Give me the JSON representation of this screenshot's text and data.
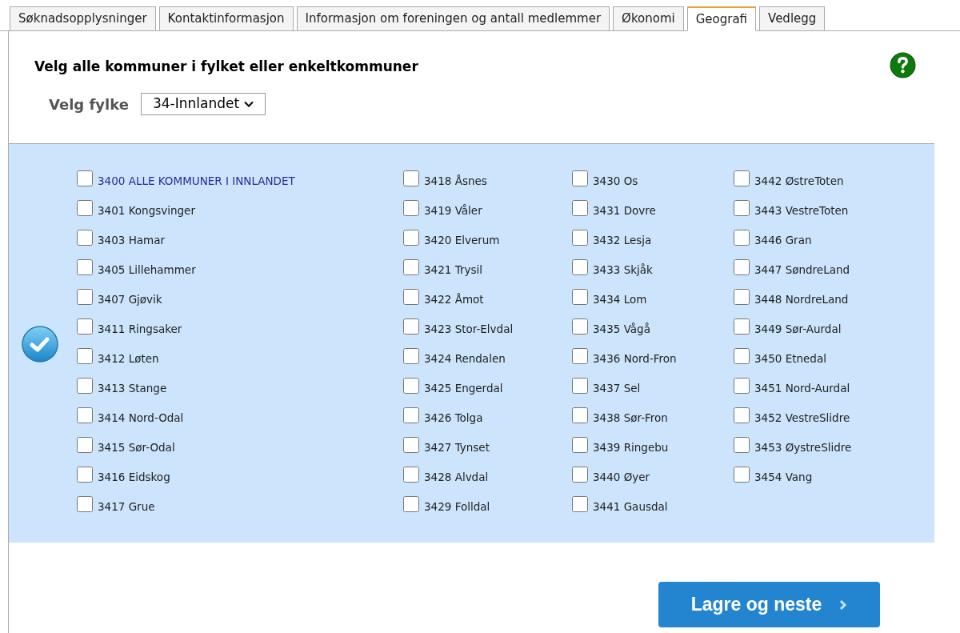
{
  "tabs": [
    {
      "label": "Søknadsopplysninger",
      "selected": false
    },
    {
      "label": "Kontaktinformasjon",
      "selected": false
    },
    {
      "label": "Informasjon om foreningen og antall medlemmer",
      "selected": false
    },
    {
      "label": "Økonomi",
      "selected": false
    },
    {
      "label": "Geografi",
      "selected": true
    },
    {
      "label": "Vedlegg",
      "selected": false
    }
  ],
  "heading": "Velg alle kommuner i fylket eller enkeltkommuner",
  "county": {
    "label": "Velg fylke",
    "value": "34-Innlandet"
  },
  "columns": [
    [
      {
        "label": "3400 ALLE KOMMUNER I INNLANDET",
        "kind": "all",
        "checked": false
      },
      {
        "label": "3401 Kongsvinger",
        "kind": "single",
        "checked": false
      },
      {
        "label": "3403 Hamar",
        "kind": "single",
        "checked": false
      },
      {
        "label": "3405 Lillehammer",
        "kind": "single",
        "checked": false
      },
      {
        "label": "3407 Gjøvik",
        "kind": "single",
        "checked": false
      },
      {
        "label": "3411 Ringsaker",
        "kind": "single",
        "checked": false
      },
      {
        "label": "3412 Løten",
        "kind": "single",
        "checked": false
      },
      {
        "label": "3413 Stange",
        "kind": "single",
        "checked": false
      },
      {
        "label": "3414 Nord-Odal",
        "kind": "single",
        "checked": false
      },
      {
        "label": "3415 Sør-Odal",
        "kind": "single",
        "checked": false
      },
      {
        "label": "3416 Eidskog",
        "kind": "single",
        "checked": false
      },
      {
        "label": "3417 Grue",
        "kind": "single",
        "checked": false
      }
    ],
    [
      {
        "label": "3418 Åsnes",
        "kind": "single",
        "checked": false
      },
      {
        "label": "3419 Våler",
        "kind": "single",
        "checked": false
      },
      {
        "label": "3420 Elverum",
        "kind": "single",
        "checked": false
      },
      {
        "label": "3421 Trysil",
        "kind": "single",
        "checked": false
      },
      {
        "label": "3422 Åmot",
        "kind": "single",
        "checked": false
      },
      {
        "label": "3423 Stor-Elvdal",
        "kind": "single",
        "checked": false
      },
      {
        "label": "3424 Rendalen",
        "kind": "single",
        "checked": false
      },
      {
        "label": "3425 Engerdal",
        "kind": "single",
        "checked": false
      },
      {
        "label": "3426 Tolga",
        "kind": "single",
        "checked": false
      },
      {
        "label": "3427 Tynset",
        "kind": "single",
        "checked": false
      },
      {
        "label": "3428 Alvdal",
        "kind": "single",
        "checked": false
      },
      {
        "label": "3429 Folldal",
        "kind": "single",
        "checked": false
      }
    ],
    [
      {
        "label": "3430 Os",
        "kind": "single",
        "checked": false
      },
      {
        "label": "3431 Dovre",
        "kind": "single",
        "checked": false
      },
      {
        "label": "3432 Lesja",
        "kind": "single",
        "checked": false
      },
      {
        "label": "3433 Skjåk",
        "kind": "single",
        "checked": false
      },
      {
        "label": "3434 Lom",
        "kind": "single",
        "checked": false
      },
      {
        "label": "3435 Vågå",
        "kind": "single",
        "checked": false
      },
      {
        "label": "3436 Nord-Fron",
        "kind": "single",
        "checked": false
      },
      {
        "label": "3437 Sel",
        "kind": "single",
        "checked": false
      },
      {
        "label": "3438 Sør-Fron",
        "kind": "single",
        "checked": false
      },
      {
        "label": "3439 Ringebu",
        "kind": "single",
        "checked": false
      },
      {
        "label": "3440 Øyer",
        "kind": "single",
        "checked": false
      },
      {
        "label": "3441 Gausdal",
        "kind": "single",
        "checked": false
      }
    ],
    [
      {
        "label": "3442 ØstreToten",
        "kind": "single",
        "checked": false
      },
      {
        "label": "3443 VestreToten",
        "kind": "single",
        "checked": false
      },
      {
        "label": "3446 Gran",
        "kind": "single",
        "checked": false
      },
      {
        "label": "3447 SøndreLand",
        "kind": "single",
        "checked": false
      },
      {
        "label": "3448 NordreLand",
        "kind": "single",
        "checked": false
      },
      {
        "label": "3449 Sør-Aurdal",
        "kind": "single",
        "checked": false
      },
      {
        "label": "3450 Etnedal",
        "kind": "single",
        "checked": false
      },
      {
        "label": "3451 Nord-Aurdal",
        "kind": "single",
        "checked": false
      },
      {
        "label": "3452 VestreSlidre",
        "kind": "single",
        "checked": false
      },
      {
        "label": "3453 ØystreSlidre",
        "kind": "single",
        "checked": false
      },
      {
        "label": "3454 Vang",
        "kind": "single",
        "checked": false
      }
    ]
  ],
  "save_button": "Lagre og neste"
}
